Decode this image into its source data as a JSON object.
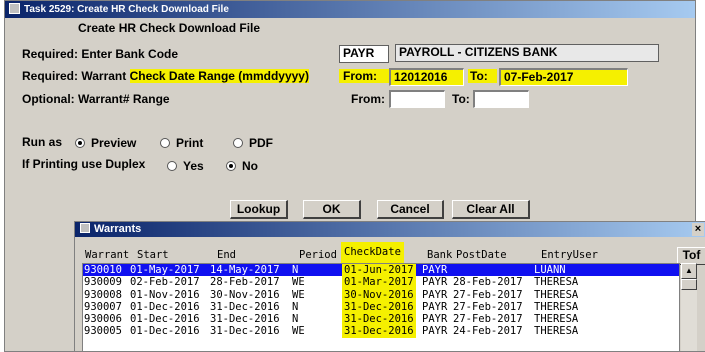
{
  "window": {
    "title": "Task 2529: Create HR Check Download File",
    "heading": "Create HR Check Download File"
  },
  "form": {
    "bank_label": "Required: Enter Bank Code",
    "bank_code": "PAYR",
    "bank_name": "PAYROLL - CITIZENS BANK",
    "range_label_prefix": "Required: Warrant ",
    "range_label_hl": "Check Date Range (mmddyyyy)",
    "from_label": "From:",
    "from_value": "12012016",
    "to_label": "To:",
    "to_value": "07-Feb-2017",
    "warrant_label": "Optional: Warrant# Range",
    "w_from_label": "From:",
    "w_to_label": "To:",
    "w_from_value": "",
    "w_to_value": "",
    "run_as_label": "Run as",
    "run_options": [
      "Preview",
      "Print",
      "PDF"
    ],
    "duplex_label": "If Printing use Duplex",
    "duplex_options": [
      "Yes",
      "No"
    ]
  },
  "buttons": {
    "lookup": "Lookup",
    "ok": "OK",
    "cancel": "Cancel",
    "clear": "Clear All"
  },
  "warrants": {
    "title": "Warrants",
    "close": "×",
    "tof": "Tof",
    "columns": [
      "Warrant",
      "Start",
      "End",
      "Period",
      "CheckDate",
      "Bank",
      "PostDate",
      "EntryUser"
    ],
    "rows": [
      [
        "930010",
        "01-May-2017",
        "14-May-2017",
        "N",
        "01-Jun-2017",
        "PAYR",
        "",
        "LUANN"
      ],
      [
        "930009",
        "02-Feb-2017",
        "28-Feb-2017",
        "WE",
        "01-Mar-2017",
        "PAYR",
        "28-Feb-2017",
        "THERESA"
      ],
      [
        "930008",
        "01-Nov-2016",
        "30-Nov-2016",
        "WE",
        "30-Nov-2016",
        "PAYR",
        "27-Feb-2017",
        "THERESA"
      ],
      [
        "930007",
        "01-Dec-2016",
        "31-Dec-2016",
        "N",
        "31-Dec-2016",
        "PAYR",
        "27-Feb-2017",
        "THERESA"
      ],
      [
        "930006",
        "01-Dec-2016",
        "31-Dec-2016",
        "N",
        "31-Dec-2016",
        "PAYR",
        "27-Feb-2017",
        "THERESA"
      ],
      [
        "930005",
        "01-Dec-2016",
        "31-Dec-2016",
        "WE",
        "31-Dec-2016",
        "PAYR",
        "24-Feb-2017",
        "THERESA"
      ]
    ]
  }
}
